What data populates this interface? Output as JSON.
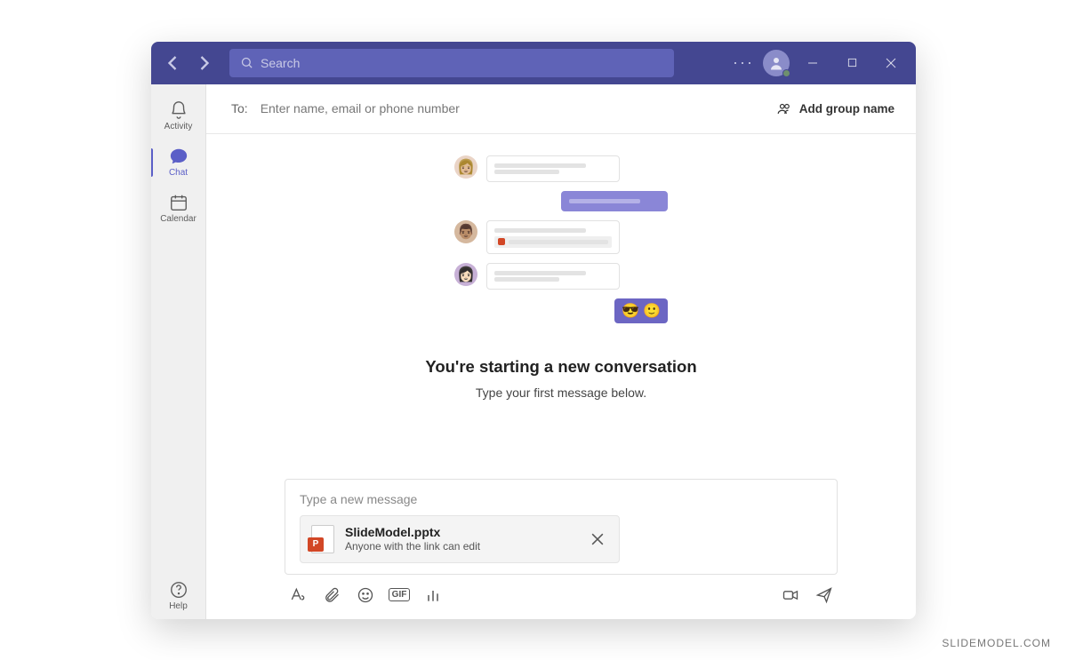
{
  "titlebar": {
    "search_placeholder": "Search"
  },
  "sidebar": {
    "activity": "Activity",
    "chat": "Chat",
    "calendar": "Calendar",
    "help": "Help"
  },
  "to": {
    "label": "To:",
    "placeholder": "Enter name, email or phone number",
    "add_group": "Add group name"
  },
  "empty": {
    "heading": "You're starting a new conversation",
    "subheading": "Type your first message below.",
    "emoji1": "😎",
    "emoji2": "🙂"
  },
  "compose": {
    "placeholder": "Type a new message",
    "attachment": {
      "name": "SlideModel.pptx",
      "permissions": "Anyone with the link can edit",
      "badge": "P"
    }
  },
  "toolbar": {
    "gif_label": "GIF"
  },
  "watermark": "SLIDEMODEL.COM"
}
